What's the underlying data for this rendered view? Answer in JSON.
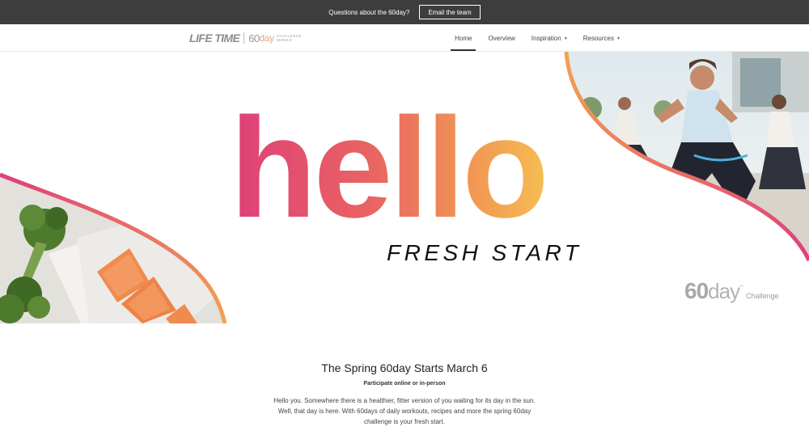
{
  "announcement": {
    "text": "Questions about the 60day?",
    "button_label": "Email the team"
  },
  "nav": {
    "logo": {
      "brand": "LIFE TIME",
      "sixty": "60",
      "day": "day",
      "challenge": "CHALLENGE",
      "series": "SERIES"
    },
    "items": [
      {
        "label": "Home",
        "active": true
      },
      {
        "label": "Overview"
      },
      {
        "label": "Inspiration",
        "icon": "chevron-down-icon"
      },
      {
        "label": "Resources",
        "icon": "chevron-down-icon"
      }
    ]
  },
  "hero": {
    "headline": "hello",
    "tagline": "FRESH START",
    "badge": {
      "number": "60",
      "word": "day",
      "tm": "™",
      "label": "Challenge"
    },
    "colors": {
      "gradient_start": "#df3f79",
      "gradient_mid": "#ee8156",
      "gradient_end": "#f6be52",
      "ribbon": "#ee7a57"
    }
  },
  "intro": {
    "title": "The Spring 60day Starts March 6",
    "subtitle": "Participate online or in-person",
    "body": "Hello you. Somewhere there is a healthier, fitter version of you waiting for its day in the sun. Well, that day is here. With 60days of daily workouts, recipes and more the spring 60day challenge is your fresh start."
  },
  "icons": {
    "chevron": "▾"
  }
}
